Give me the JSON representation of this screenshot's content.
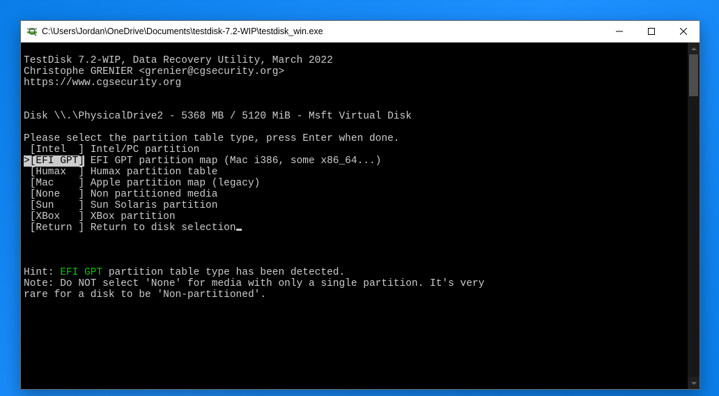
{
  "window": {
    "title": "C:\\Users\\Jordan\\OneDrive\\Documents\\testdisk-7.2-WIP\\testdisk_win.exe"
  },
  "header": {
    "line1": "TestDisk 7.2-WIP, Data Recovery Utility, March 2022",
    "line2": "Christophe GRENIER <grenier@cgsecurity.org>",
    "line3": "https://www.cgsecurity.org"
  },
  "disk": "Disk \\\\.\\PhysicalDrive2 - 5368 MB / 5120 MiB - Msft Virtual Disk",
  "prompt": "Please select the partition table type, press Enter when done.",
  "options": [
    {
      "selected": false,
      "label": " [Intel  ]",
      "desc": " Intel/PC partition"
    },
    {
      "selected": true,
      "label": ">[EFI GPT]",
      "desc": " EFI GPT partition map (Mac i386, some x86_64...)"
    },
    {
      "selected": false,
      "label": " [Humax  ]",
      "desc": " Humax partition table"
    },
    {
      "selected": false,
      "label": " [Mac    ]",
      "desc": " Apple partition map (legacy)"
    },
    {
      "selected": false,
      "label": " [None   ]",
      "desc": " Non partitioned media"
    },
    {
      "selected": false,
      "label": " [Sun    ]",
      "desc": " Sun Solaris partition"
    },
    {
      "selected": false,
      "label": " [XBox   ]",
      "desc": " XBox partition"
    },
    {
      "selected": false,
      "label": " [Return ]",
      "desc": " Return to disk selection"
    }
  ],
  "hint": {
    "label": "Hint: ",
    "key": "EFI GPT",
    "rest": " partition table type has been detected."
  },
  "note": {
    "line1": "Note: Do NOT select 'None' for media with only a single partition. It's very",
    "line2": "rare for a disk to be 'Non-partitioned'."
  }
}
